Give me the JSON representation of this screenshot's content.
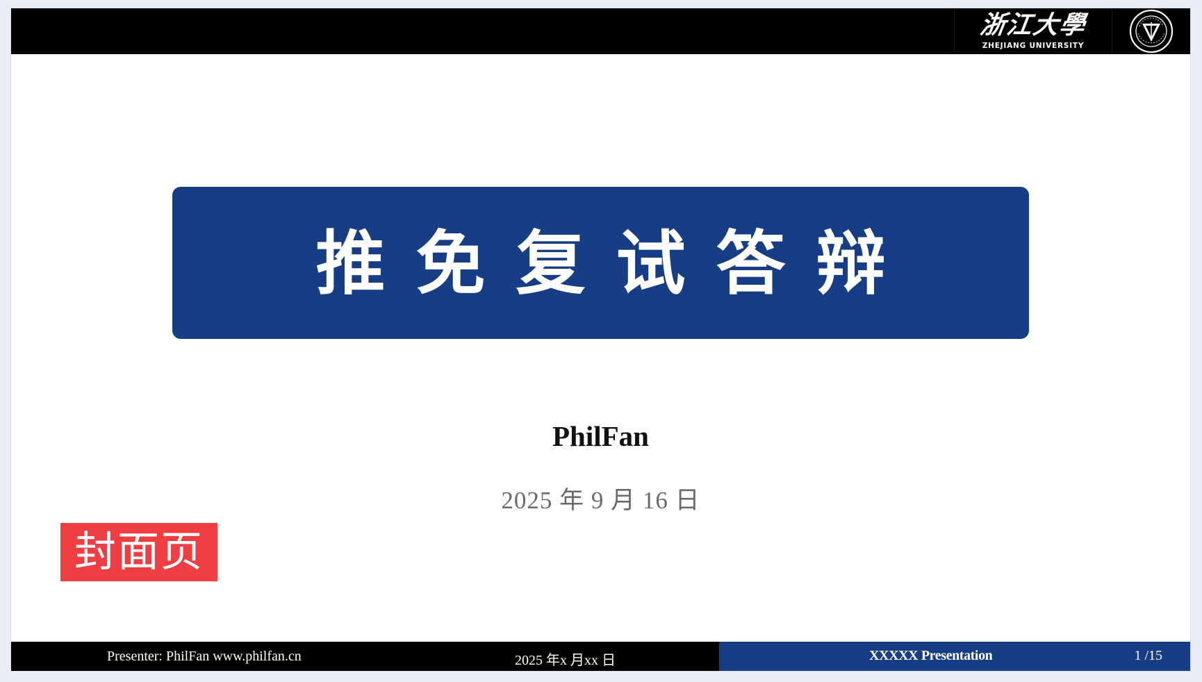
{
  "logo": {
    "cn_name": "浙江大學",
    "en_name": "ZHEJIANG UNIVERSITY"
  },
  "slide": {
    "title": "推免复试答辩",
    "author": "PhilFan",
    "date": "2025 年 9 月 16 日",
    "page_tag": "封面页"
  },
  "footer": {
    "presenter": "Presenter: PhilFan www.philfan.cn",
    "date": "2025 年x 月xx 日",
    "presentation": "XXXXX Presentation",
    "page": "1 /15"
  },
  "colors": {
    "primary_blue": "#173e84",
    "black_bar": "#000000",
    "tag_red": "#ef3e42",
    "date_gray": "#6a6a6a"
  },
  "icons": {
    "emblem": "zju-emblem-icon"
  }
}
